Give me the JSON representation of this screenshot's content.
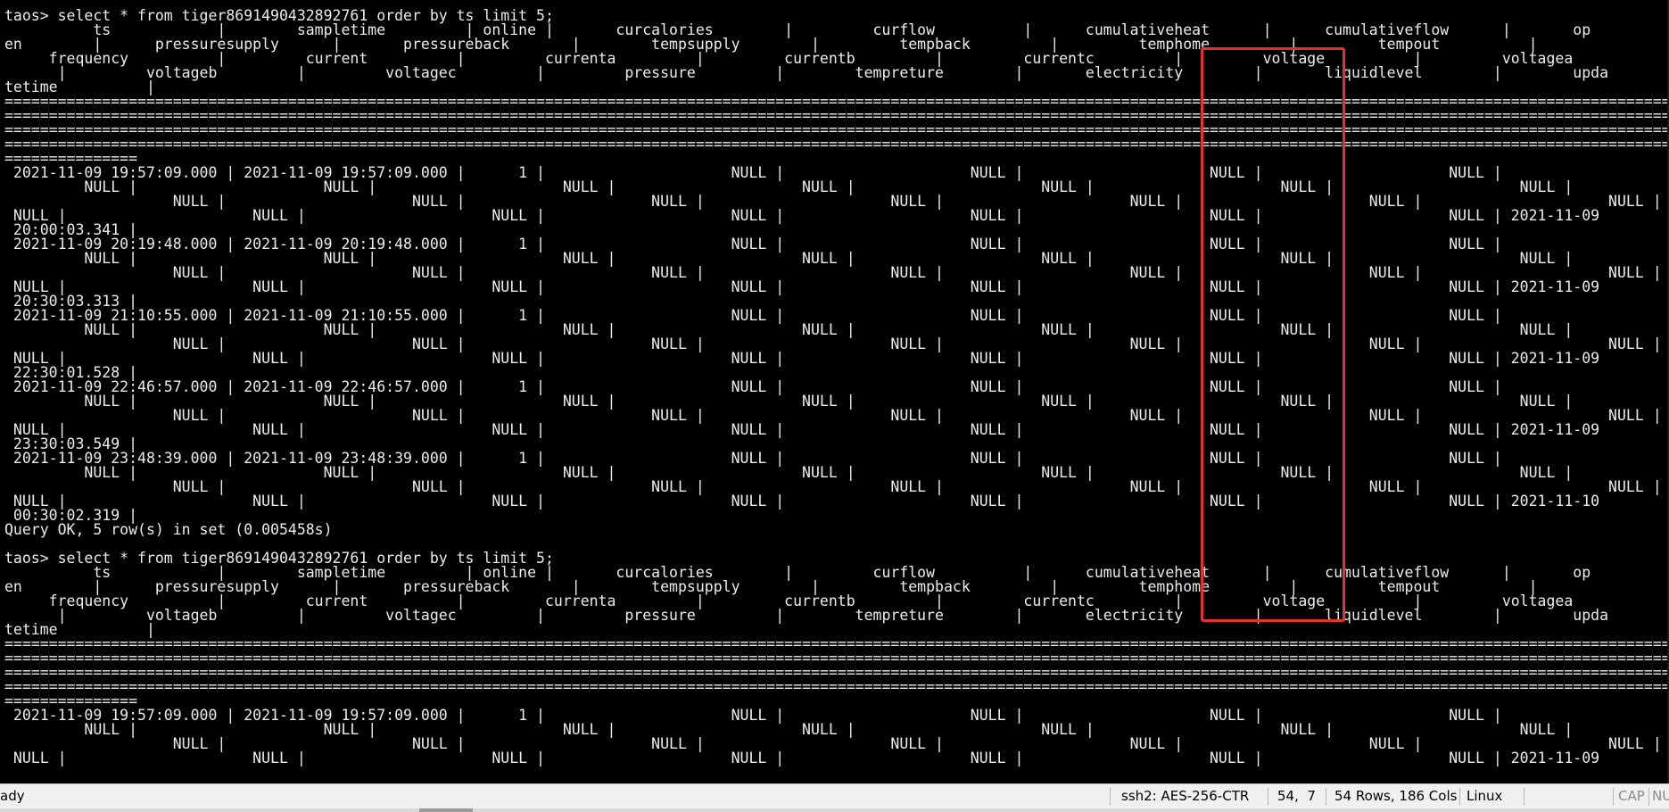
{
  "terminal": {
    "prompt": "taos>",
    "query": "select * from tiger8691490432892761 order by ts limit 5;",
    "output": "taos> select * from tiger8691490432892761 order by ts limit 5;\n          ts            |        sampletime         | online |       curcalories        |         curflow          |      cumulativeheat      |      cumulativeflow      |       op\nen        |      pressuresupply      |       pressureback       |        tempsupply        |         tempback         |         temphome         |         tempout          |\n     frequency          |         current          |         currenta         |         currentb         |         currentc         |         voltage          |         voltagea\n      |         voltageb         |         voltagec         |         pressure         |        tempreture        |       electricity        |       liquidlevel        |        upda\ntetime          |\n============================================================================================================================================================================================\n============================================================================================================================================================================================\n============================================================================================================================================================================================\n============================================================================================================================================================================================\n===============\n 2021-11-09 19:57:09.000 | 2021-11-09 19:57:09.000 |      1 |                     NULL |                     NULL |                     NULL |                     NULL |\n         NULL |                     NULL |                     NULL |                     NULL |                     NULL |                     NULL |                     NULL |\n                   NULL |                     NULL |                     NULL |                     NULL |                     NULL |                     NULL |                     NULL |\n NULL |                     NULL |                     NULL |                     NULL |                     NULL |                     NULL |                     NULL | 2021-11-09\n 20:00:03.341 |\n 2021-11-09 20:19:48.000 | 2021-11-09 20:19:48.000 |      1 |                     NULL |                     NULL |                     NULL |                     NULL |\n         NULL |                     NULL |                     NULL |                     NULL |                     NULL |                     NULL |                     NULL |\n                   NULL |                     NULL |                     NULL |                     NULL |                     NULL |                     NULL |                     NULL |\n NULL |                     NULL |                     NULL |                     NULL |                     NULL |                     NULL |                     NULL | 2021-11-09\n 20:30:03.313 |\n 2021-11-09 21:10:55.000 | 2021-11-09 21:10:55.000 |      1 |                     NULL |                     NULL |                     NULL |                     NULL |\n         NULL |                     NULL |                     NULL |                     NULL |                     NULL |                     NULL |                     NULL |\n                   NULL |                     NULL |                     NULL |                     NULL |                     NULL |                     NULL |                     NULL |\n NULL |                     NULL |                     NULL |                     NULL |                     NULL |                     NULL |                     NULL | 2021-11-09\n 22:30:01.528 |\n 2021-11-09 22:46:57.000 | 2021-11-09 22:46:57.000 |      1 |                     NULL |                     NULL |                     NULL |                     NULL |\n         NULL |                     NULL |                     NULL |                     NULL |                     NULL |                     NULL |                     NULL |\n                   NULL |                     NULL |                     NULL |                     NULL |                     NULL |                     NULL |                     NULL |\n NULL |                     NULL |                     NULL |                     NULL |                     NULL |                     NULL |                     NULL | 2021-11-09\n 23:30:03.549 |\n 2021-11-09 23:48:39.000 | 2021-11-09 23:48:39.000 |      1 |                     NULL |                     NULL |                     NULL |                     NULL |\n         NULL |                     NULL |                     NULL |                     NULL |                     NULL |                     NULL |                     NULL |\n                   NULL |                     NULL |                     NULL |                     NULL |                     NULL |                     NULL |                     NULL |\n NULL |                     NULL |                     NULL |                     NULL |                     NULL |                     NULL |                     NULL | 2021-11-10\n 00:30:02.319 |\nQuery OK, 5 row(s) in set (0.005458s)\n\ntaos> select * from tiger8691490432892761 order by ts limit 5;\n          ts            |        sampletime         | online |       curcalories        |         curflow          |      cumulativeheat      |      cumulativeflow      |       op\nen        |      pressuresupply      |       pressureback       |        tempsupply        |         tempback         |         temphome         |         tempout          |\n     frequency          |         current          |         currenta         |         currentb         |         currentc         |         voltage          |         voltagea\n      |         voltageb         |         voltagec         |         pressure         |        tempreture        |       electricity        |       liquidlevel        |        upda\ntetime          |\n============================================================================================================================================================================================\n============================================================================================================================================================================================\n============================================================================================================================================================================================\n============================================================================================================================================================================================\n===============\n 2021-11-09 19:57:09.000 | 2021-11-09 19:57:09.000 |      1 |                     NULL |                     NULL |                     NULL |                     NULL |\n         NULL |                     NULL |                     NULL |                     NULL |                     NULL |                     NULL |                     NULL |\n                   NULL |                     NULL |                     NULL |                     NULL |                     NULL |                     NULL |                     NULL |\n NULL |                     NULL |                     NULL |                     NULL |                     NULL |                     NULL |                     NULL | 2021-11-09"
  },
  "statusbar": {
    "ready": "ady",
    "connection": "ssh2: AES-256-CTR",
    "cursor": "54,  7",
    "size": "54 Rows, 186 Cols",
    "os": "Linux",
    "cap": "CAP",
    "num": "NU"
  }
}
